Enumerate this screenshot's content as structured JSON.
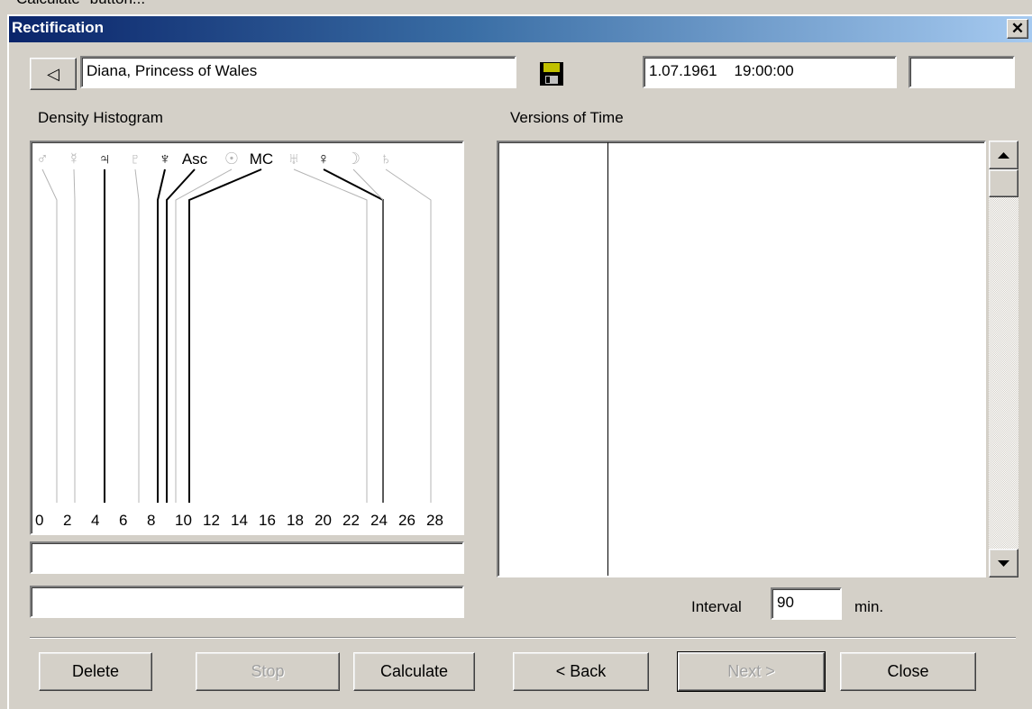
{
  "caption_top": "Calculate\" button...",
  "window": {
    "title": "Rectification",
    "close_glyph": "✕"
  },
  "header": {
    "back_glyph": "◁",
    "name_value": "Diana, Princess of Wales",
    "save_icon": "floppy-disk-icon",
    "datetime_value": "1.07.1961    19:00:00",
    "extra_value": ""
  },
  "histogram": {
    "label": "Density Histogram",
    "symbols": [
      "♂",
      "☿",
      "♃",
      "♇",
      "♆",
      "Asc",
      "☉",
      "MC",
      "♅",
      "♀",
      "☽",
      "♄"
    ],
    "symbol_active": [
      false,
      false,
      true,
      false,
      true,
      true,
      false,
      true,
      false,
      true,
      false,
      false
    ],
    "axis_ticks": [
      "0",
      "2",
      "4",
      "6",
      "8",
      "10",
      "12",
      "14",
      "16",
      "18",
      "20",
      "22",
      "24",
      "26",
      "28"
    ],
    "field1_value": "",
    "field2_value": ""
  },
  "versions": {
    "label": "Versions of Time"
  },
  "interval": {
    "label": "Interval",
    "value": "90",
    "unit": "min."
  },
  "buttons": {
    "delete": "Delete",
    "stop": "Stop",
    "calculate": "Calculate",
    "back": "< Back",
    "next": "Next >",
    "close": "Close"
  },
  "colors": {
    "title_start": "#0a246a",
    "title_end": "#a6caf0",
    "face": "#d4d0c8",
    "inactive_symbol": "#b4b4b4"
  }
}
